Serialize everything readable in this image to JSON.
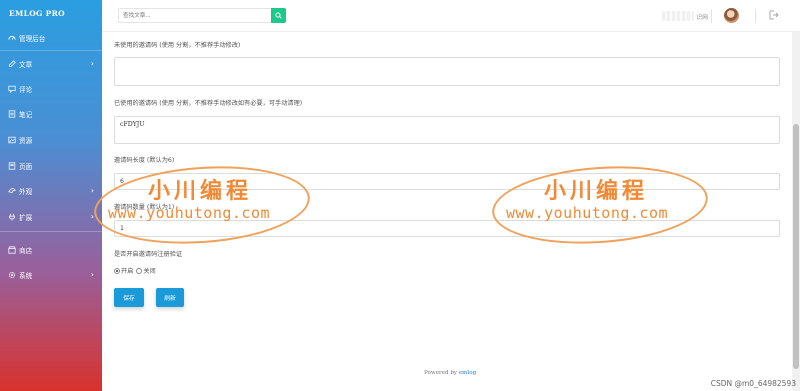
{
  "brand": "EMLOG PRO",
  "nav": [
    {
      "label": "管理后台",
      "icon": "dashboard-icon",
      "chevron": false
    },
    {
      "label": "文章",
      "icon": "edit-icon",
      "chevron": true
    },
    {
      "label": "评论",
      "icon": "comment-icon",
      "chevron": false
    },
    {
      "label": "笔记",
      "icon": "note-icon",
      "chevron": false
    },
    {
      "label": "资源",
      "icon": "image-icon",
      "chevron": false
    },
    {
      "label": "页面",
      "icon": "page-icon",
      "chevron": false
    },
    {
      "label": "外观",
      "icon": "palette-icon",
      "chevron": true
    },
    {
      "label": "扩展",
      "icon": "plugin-icon",
      "chevron": true
    },
    {
      "label": "商店",
      "icon": "store-icon",
      "chevron": false
    },
    {
      "label": "系统",
      "icon": "gear-icon",
      "chevron": true
    }
  ],
  "header": {
    "search_placeholder": "查找文章...",
    "help_label": "识网"
  },
  "form": {
    "unused_label": "未使用的邀请码 (使用 分割，不推荐手动修改)",
    "unused_value": "",
    "used_label": "已使用的邀请码 (使用 分割，不推荐手动修改如有必要，可手动清理)",
    "used_value": "cFDYJU",
    "length_label": "邀请码长度 (默认为6)",
    "length_value": "6",
    "count_label": "邀请码数量 (默认为1)",
    "count_value": "1",
    "verify_label": "是否开启邀请码注册验证",
    "radio_on_label": "开启",
    "radio_off_label": "关闭",
    "radio_selected": "开启",
    "save_label": "保存",
    "refresh_label": "刷新"
  },
  "footer": {
    "powered_by": "Powered by",
    "link": "emlog"
  },
  "watermarks": [
    {
      "title": "小川编程",
      "url": "www.youhutong.com"
    },
    {
      "title": "小川编程",
      "url": "www.youhutong.com"
    }
  ],
  "csdn_credit": "CSDN @m0_64982593",
  "colors": {
    "accent": "#1b9ad9",
    "search_button": "#1cc88a",
    "watermark": "#f08a36"
  }
}
